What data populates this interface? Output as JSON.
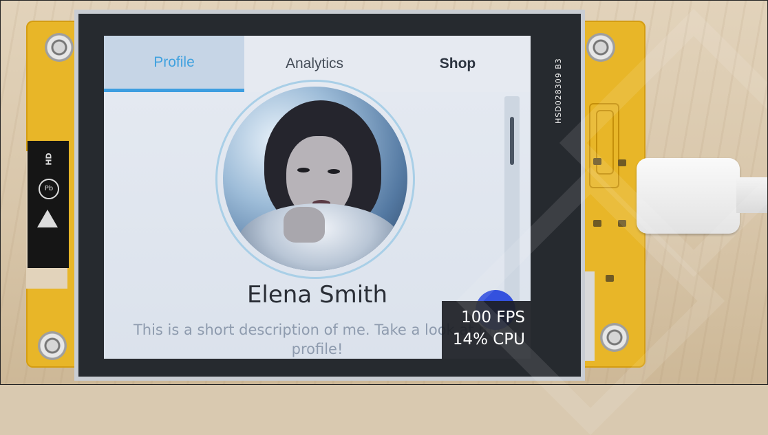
{
  "tabs": [
    {
      "label": "Profile",
      "active": true
    },
    {
      "label": "Analytics",
      "active": false
    },
    {
      "label": "Shop",
      "active": false
    }
  ],
  "profile": {
    "name": "Elena Smith",
    "description": "This is a short description of me. Take a look at my profile!",
    "avatar_icon": "user-photo"
  },
  "perf_monitor": {
    "fps": "100 FPS",
    "cpu": "14% CPU"
  },
  "board": {
    "silkscreen": "HSD028309 B3",
    "label_hd": "HD",
    "label_pb": "Pb"
  },
  "colors": {
    "accent": "#3d9ee0",
    "fab": "#3451de",
    "pcb": "#e8b628",
    "bezel": "#262a2f"
  }
}
